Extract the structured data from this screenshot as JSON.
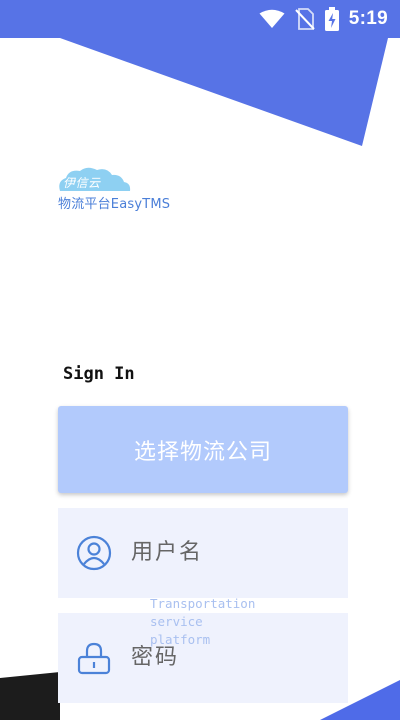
{
  "status_bar": {
    "time": "5:19",
    "icons": [
      "wifi-icon",
      "no-sim-icon",
      "battery-charging-icon"
    ]
  },
  "logo": {
    "brand": "伊信云",
    "tagline": "物流平台EasyTMS"
  },
  "login": {
    "title": "Sign In",
    "company_button": "选择物流公司",
    "username_placeholder": "用户名",
    "password_placeholder": "密码"
  },
  "watermark": {
    "line1": "Transportation",
    "line2": "service",
    "line3": "platform"
  },
  "colors": {
    "primary": "#5773e6",
    "button": "#b2cafc",
    "field_background": "#eff2fd",
    "icon": "#4b82d8"
  }
}
